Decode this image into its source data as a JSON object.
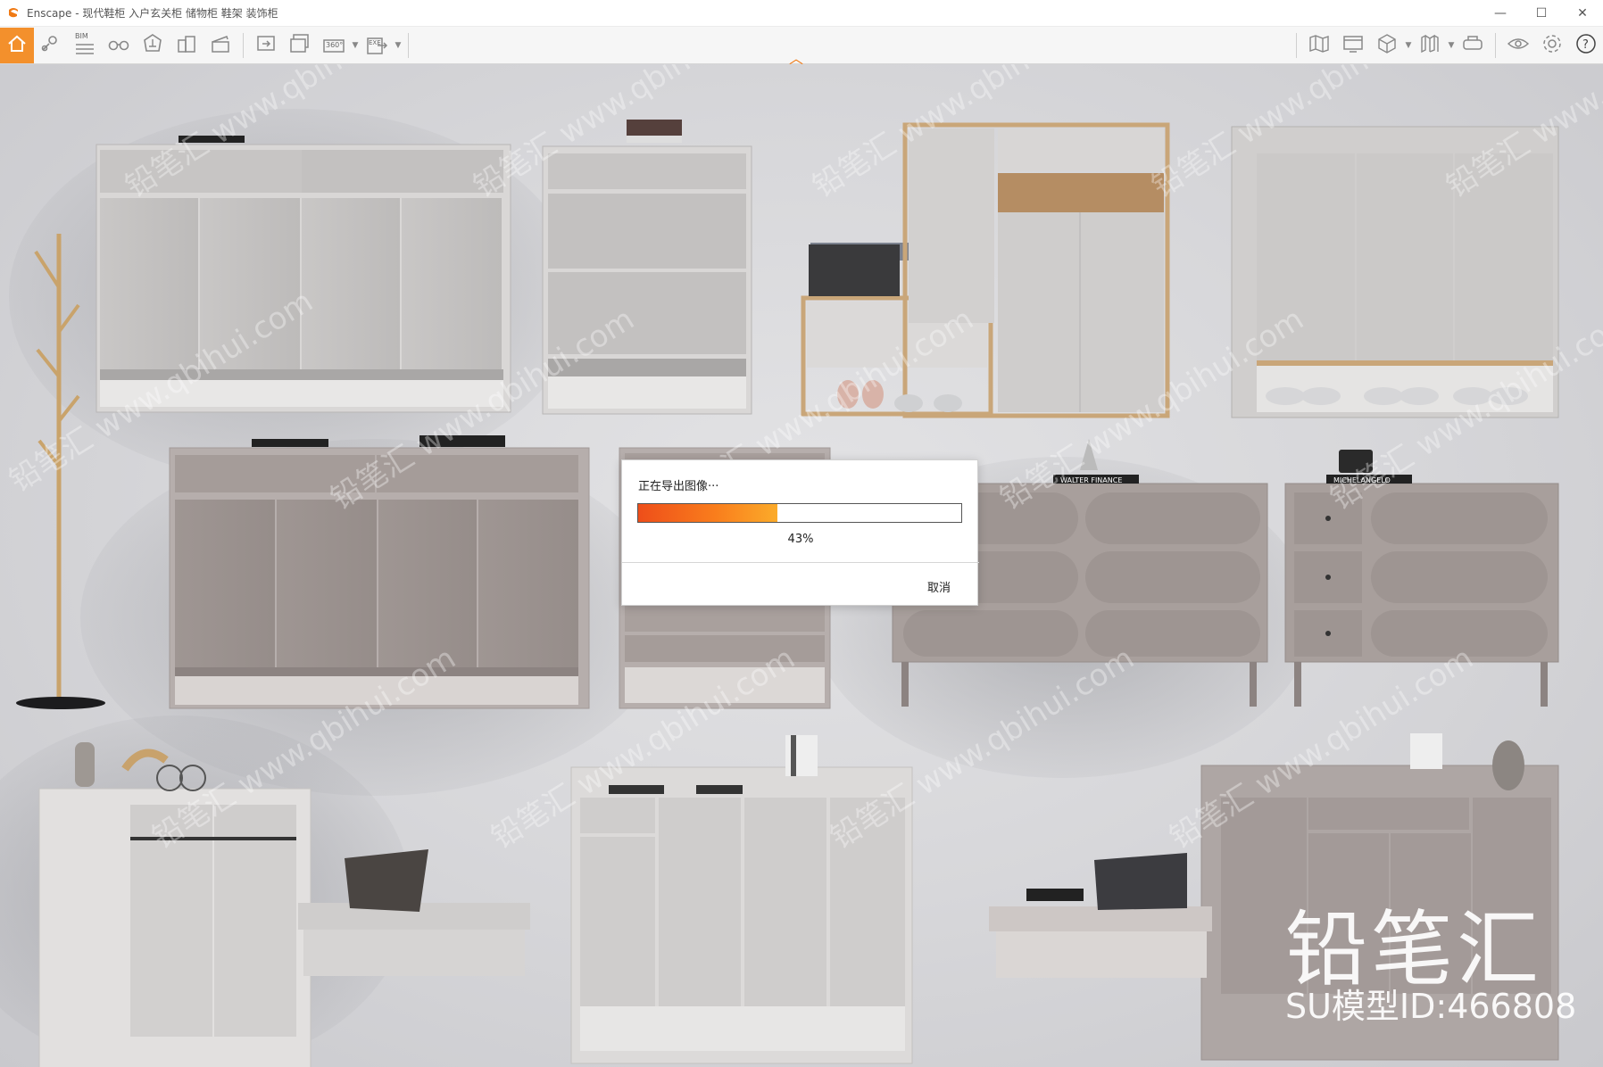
{
  "window": {
    "app_icon": "enscape-logo-icon",
    "title": "Enscape - 现代鞋柜 入户玄关柜 储物柜 鞋架 装饰柜",
    "controls": {
      "minimize": "—",
      "maximize": "☐",
      "close": "✕"
    }
  },
  "toolbar": {
    "left_buttons": [
      {
        "name": "home-icon"
      },
      {
        "name": "location-pin-icon"
      },
      {
        "name": "bim-icon",
        "label": "BIM"
      },
      {
        "name": "binoculars-icon"
      },
      {
        "name": "sync-icon"
      },
      {
        "name": "buildings-icon"
      },
      {
        "name": "clapper-icon"
      },
      {
        "name": "screenshot-export-icon"
      },
      {
        "name": "batch-export-icon"
      },
      {
        "name": "panorama-360-icon",
        "label": "360°"
      },
      {
        "name": "export-file-icon"
      },
      {
        "name": "exe-export-icon",
        "label": "EXE"
      }
    ],
    "right_buttons": [
      {
        "name": "map-icon"
      },
      {
        "name": "monitor-icon"
      },
      {
        "name": "cube-icon"
      },
      {
        "name": "book-icon"
      },
      {
        "name": "vr-headset-icon"
      },
      {
        "name": "eye-icon"
      },
      {
        "name": "gear-icon"
      },
      {
        "name": "help-icon"
      }
    ],
    "accent": "#f3902c"
  },
  "watermark": {
    "brand": "铅笔汇",
    "model_id": "SU模型ID:466808",
    "repeat_text": "铅笔汇 www.qbihui.com"
  },
  "scene_labels": {
    "book_walter": "WALTER FINANCE",
    "book_michelangelo": "MICHELANGELO"
  },
  "export_dialog": {
    "title": "正在导出图像···",
    "progress": 0.43,
    "percent_label": "43%",
    "cancel_label": "取消"
  }
}
